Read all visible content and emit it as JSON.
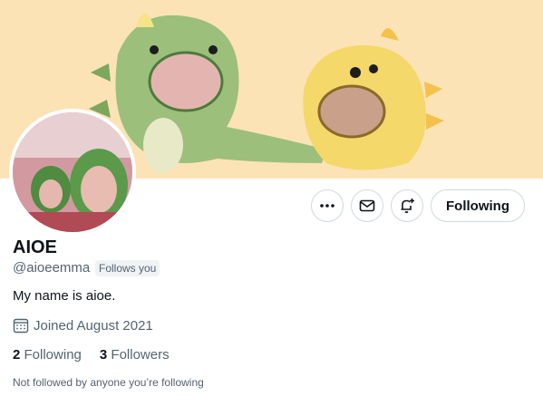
{
  "profile": {
    "name": "AIOE",
    "handle": "@aioeemma",
    "follows_you": "Follows you",
    "bio": "My name is aioe.",
    "joined": "Joined August 2021",
    "following_count": "2",
    "following_label": "Following",
    "followers_count": "3",
    "followers_label": "Followers",
    "note": "Not followed by anyone you’re following"
  },
  "actions": {
    "more_icon": "ellipsis-icon",
    "message_icon": "envelope-icon",
    "notify_icon": "bell-plus-icon",
    "follow_label": "Following"
  },
  "colors": {
    "banner_bg": "#fbe3b6",
    "dino_green": "#9cbf7c",
    "dino_yellow": "#f5d86a",
    "text_primary": "#0f1419",
    "text_secondary": "#536471"
  }
}
